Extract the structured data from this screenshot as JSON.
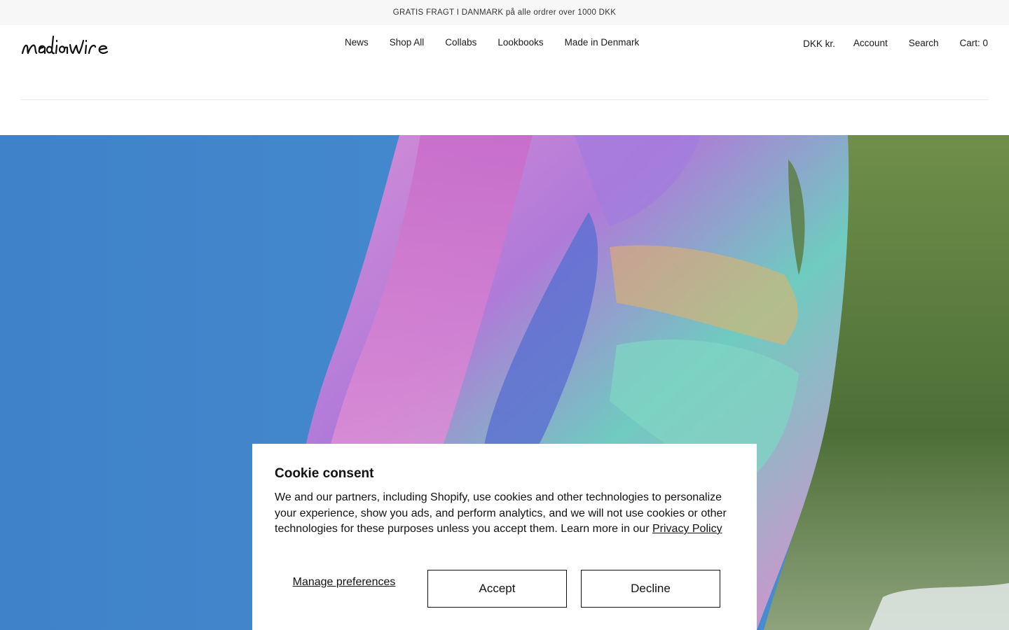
{
  "announcement": {
    "text": "GRATIS FRAGT I DANMARK på alle ordrer over 1000 DKK"
  },
  "header": {
    "logo_text": "nadiawire",
    "main_nav": [
      "News",
      "Shop All",
      "Collabs",
      "Lookbooks",
      "Made in Denmark"
    ],
    "currency": "DKK kr.",
    "account_label": "Account",
    "search_label": "Search",
    "cart_label": "Cart: 0"
  },
  "hero": {
    "image": "knit-garment-against-blue-sky-video"
  },
  "cookie_consent": {
    "title": "Cookie consent",
    "body": "We and our partners, including Shopify, use cookies and other technologies to personalize your experience, show you ads, and perform analytics, and we will not use cookies or other technologies for these purposes unless you accept them. Learn more in our ",
    "privacy_link": "Privacy Policy",
    "manage_label": "Manage preferences",
    "accept_label": "Accept",
    "decline_label": "Decline"
  },
  "colors": {
    "announcement_bg": "#f7f7f7",
    "sky_blue": "#3d7fc7",
    "text": "#1a1a1a"
  }
}
